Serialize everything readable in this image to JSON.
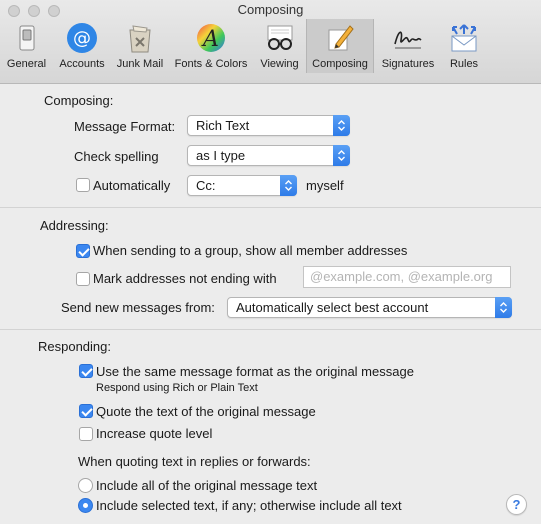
{
  "window": {
    "title": "Composing"
  },
  "toolbar": {
    "items": [
      {
        "label": "General",
        "icon": "general-switch-icon"
      },
      {
        "label": "Accounts",
        "icon": "at-sign-icon"
      },
      {
        "label": "Junk Mail",
        "icon": "junk-mail-trash-icon"
      },
      {
        "label": "Fonts & Colors",
        "icon": "fonts-colors-icon"
      },
      {
        "label": "Viewing",
        "icon": "glasses-icon"
      },
      {
        "label": "Composing",
        "icon": "pencil-icon",
        "active": true
      },
      {
        "label": "Signatures",
        "icon": "signature-icon"
      },
      {
        "label": "Rules",
        "icon": "rules-icon"
      }
    ]
  },
  "composing": {
    "heading": "Composing:",
    "message_format_label": "Message Format:",
    "message_format_value": "Rich Text",
    "check_spelling_label": "Check spelling",
    "check_spelling_value": "as I type",
    "auto_label": "Automatically",
    "auto_checked": false,
    "auto_value": "Cc:",
    "myself_label": "myself"
  },
  "addressing": {
    "heading": "Addressing:",
    "group_label": "When sending to a group, show all member addresses",
    "group_checked": true,
    "mark_label": "Mark addresses not ending with",
    "mark_checked": false,
    "mark_placeholder": "@example.com, @example.org",
    "send_from_label": "Send new messages from:",
    "send_from_value": "Automatically select best account"
  },
  "responding": {
    "heading": "Responding:",
    "same_format_label": "Use the same message format as the original message",
    "same_format_checked": true,
    "same_format_sub": "Respond using Rich or Plain Text",
    "quote_label": "Quote the text of the original message",
    "quote_checked": true,
    "increase_label": "Increase quote level",
    "increase_checked": false,
    "quoting_heading": "When quoting text in replies or forwards:",
    "include_all_label": "Include all of the original message text",
    "include_selected_label": "Include selected text, if any; otherwise include all text",
    "selected_option": "include_selected"
  },
  "help_label": "?",
  "colors": {
    "accent": "#3b87f0",
    "window_bg": "#ececec"
  }
}
